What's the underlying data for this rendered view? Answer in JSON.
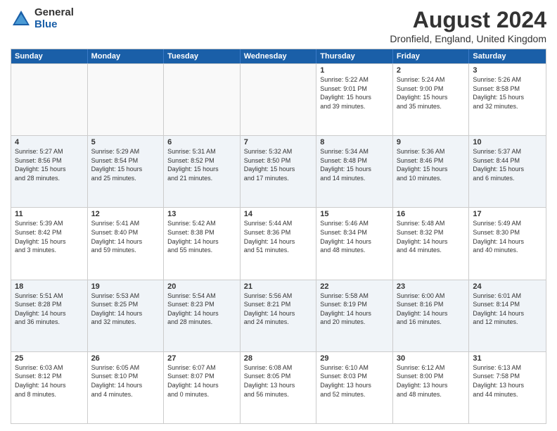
{
  "logo": {
    "general": "General",
    "blue": "Blue"
  },
  "header": {
    "title": "August 2024",
    "subtitle": "Dronfield, England, United Kingdom"
  },
  "weekdays": [
    "Sunday",
    "Monday",
    "Tuesday",
    "Wednesday",
    "Thursday",
    "Friday",
    "Saturday"
  ],
  "rows": [
    [
      {
        "day": "",
        "empty": true
      },
      {
        "day": "",
        "empty": true
      },
      {
        "day": "",
        "empty": true
      },
      {
        "day": "",
        "empty": true
      },
      {
        "day": "1",
        "info": "Sunrise: 5:22 AM\nSunset: 9:01 PM\nDaylight: 15 hours\nand 39 minutes."
      },
      {
        "day": "2",
        "info": "Sunrise: 5:24 AM\nSunset: 9:00 PM\nDaylight: 15 hours\nand 35 minutes."
      },
      {
        "day": "3",
        "info": "Sunrise: 5:26 AM\nSunset: 8:58 PM\nDaylight: 15 hours\nand 32 minutes."
      }
    ],
    [
      {
        "day": "4",
        "info": "Sunrise: 5:27 AM\nSunset: 8:56 PM\nDaylight: 15 hours\nand 28 minutes."
      },
      {
        "day": "5",
        "info": "Sunrise: 5:29 AM\nSunset: 8:54 PM\nDaylight: 15 hours\nand 25 minutes."
      },
      {
        "day": "6",
        "info": "Sunrise: 5:31 AM\nSunset: 8:52 PM\nDaylight: 15 hours\nand 21 minutes."
      },
      {
        "day": "7",
        "info": "Sunrise: 5:32 AM\nSunset: 8:50 PM\nDaylight: 15 hours\nand 17 minutes."
      },
      {
        "day": "8",
        "info": "Sunrise: 5:34 AM\nSunset: 8:48 PM\nDaylight: 15 hours\nand 14 minutes."
      },
      {
        "day": "9",
        "info": "Sunrise: 5:36 AM\nSunset: 8:46 PM\nDaylight: 15 hours\nand 10 minutes."
      },
      {
        "day": "10",
        "info": "Sunrise: 5:37 AM\nSunset: 8:44 PM\nDaylight: 15 hours\nand 6 minutes."
      }
    ],
    [
      {
        "day": "11",
        "info": "Sunrise: 5:39 AM\nSunset: 8:42 PM\nDaylight: 15 hours\nand 3 minutes."
      },
      {
        "day": "12",
        "info": "Sunrise: 5:41 AM\nSunset: 8:40 PM\nDaylight: 14 hours\nand 59 minutes."
      },
      {
        "day": "13",
        "info": "Sunrise: 5:42 AM\nSunset: 8:38 PM\nDaylight: 14 hours\nand 55 minutes."
      },
      {
        "day": "14",
        "info": "Sunrise: 5:44 AM\nSunset: 8:36 PM\nDaylight: 14 hours\nand 51 minutes."
      },
      {
        "day": "15",
        "info": "Sunrise: 5:46 AM\nSunset: 8:34 PM\nDaylight: 14 hours\nand 48 minutes."
      },
      {
        "day": "16",
        "info": "Sunrise: 5:48 AM\nSunset: 8:32 PM\nDaylight: 14 hours\nand 44 minutes."
      },
      {
        "day": "17",
        "info": "Sunrise: 5:49 AM\nSunset: 8:30 PM\nDaylight: 14 hours\nand 40 minutes."
      }
    ],
    [
      {
        "day": "18",
        "info": "Sunrise: 5:51 AM\nSunset: 8:28 PM\nDaylight: 14 hours\nand 36 minutes."
      },
      {
        "day": "19",
        "info": "Sunrise: 5:53 AM\nSunset: 8:25 PM\nDaylight: 14 hours\nand 32 minutes."
      },
      {
        "day": "20",
        "info": "Sunrise: 5:54 AM\nSunset: 8:23 PM\nDaylight: 14 hours\nand 28 minutes."
      },
      {
        "day": "21",
        "info": "Sunrise: 5:56 AM\nSunset: 8:21 PM\nDaylight: 14 hours\nand 24 minutes."
      },
      {
        "day": "22",
        "info": "Sunrise: 5:58 AM\nSunset: 8:19 PM\nDaylight: 14 hours\nand 20 minutes."
      },
      {
        "day": "23",
        "info": "Sunrise: 6:00 AM\nSunset: 8:16 PM\nDaylight: 14 hours\nand 16 minutes."
      },
      {
        "day": "24",
        "info": "Sunrise: 6:01 AM\nSunset: 8:14 PM\nDaylight: 14 hours\nand 12 minutes."
      }
    ],
    [
      {
        "day": "25",
        "info": "Sunrise: 6:03 AM\nSunset: 8:12 PM\nDaylight: 14 hours\nand 8 minutes."
      },
      {
        "day": "26",
        "info": "Sunrise: 6:05 AM\nSunset: 8:10 PM\nDaylight: 14 hours\nand 4 minutes."
      },
      {
        "day": "27",
        "info": "Sunrise: 6:07 AM\nSunset: 8:07 PM\nDaylight: 14 hours\nand 0 minutes."
      },
      {
        "day": "28",
        "info": "Sunrise: 6:08 AM\nSunset: 8:05 PM\nDaylight: 13 hours\nand 56 minutes."
      },
      {
        "day": "29",
        "info": "Sunrise: 6:10 AM\nSunset: 8:03 PM\nDaylight: 13 hours\nand 52 minutes."
      },
      {
        "day": "30",
        "info": "Sunrise: 6:12 AM\nSunset: 8:00 PM\nDaylight: 13 hours\nand 48 minutes."
      },
      {
        "day": "31",
        "info": "Sunrise: 6:13 AM\nSunset: 7:58 PM\nDaylight: 13 hours\nand 44 minutes."
      }
    ]
  ]
}
